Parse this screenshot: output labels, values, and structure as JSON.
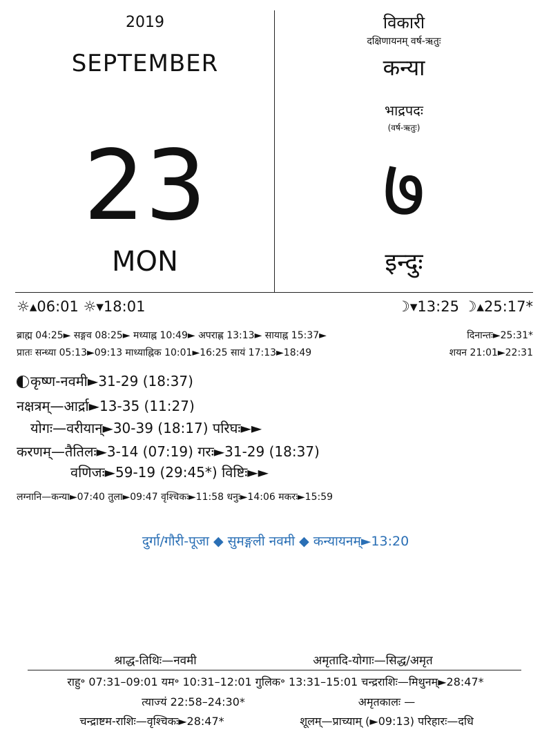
{
  "header": {
    "year": "2019",
    "month": "SEPTEMBER",
    "day": "23",
    "weekday": "MON",
    "samvatsara": "विकारी",
    "ayana_ritu": "दक्षिणायनम्   वर्ष-ऋतुः",
    "solar_month": "कन्या",
    "lunar_month": "भाद्रपदः",
    "lunar_ritu": "(वर्ष-ऋतुः)",
    "solar_day": "७",
    "vasara": "इन्दुः"
  },
  "sun_moon": {
    "sun_left": "☼▴06:01 ☼▾18:01",
    "moon_right": "☽▾13:25  ☽▴25:17*"
  },
  "kaala": {
    "line1_left": "ब्राह्म 04:25► सङ्गव 08:25► मध्याह्न 10:49► अपराह्ण 13:13► सायाह्न 15:37►",
    "line1_right": "दिनान्तः►25:31*",
    "line2_left": "प्रातः सन्ध्या 05:13►09:13 माध्याह्निक 10:01►16:25 सायं 17:13►18:49",
    "line2_right": "शयन 21:01►22:31"
  },
  "panchanga": {
    "tithi": "कृष्ण-नवमी►31-29 (18:37)",
    "nakshatra": "नक्षत्रम्—आर्द्रा►13-35 (11:27)",
    "yoga": "योगः—वरीयान्►30-39 (18:17)  परिघः►►",
    "karana1": "करणम्—तैतिलः►3-14 (07:19)  गरः►31-29 (18:37)",
    "karana2": "वणिजः►59-19 (29:45*)  विष्टिः►►",
    "lagna": "लग्नानि—कन्या►07:40 तुला►09:47 वृश्चिकः►11:58 धनुः►14:06 मकरः►15:59"
  },
  "festivals": {
    "text": "दुर्गा/गौरी-पूजा ◆ सुमङ्गली नवमी ◆ कन्यायनम्►13:20",
    "color": "#2a6fb5"
  },
  "footer": {
    "shraddha": "श्राद्ध-तिथिः—नवमी",
    "amritadi": "अमृतादि-योगाः—सिद्ध/अमृत",
    "row1": "राहु॰ 07:31–09:01   यम॰ 10:31–12:01   गुलिक॰ 13:31–15:01  चन्द्रराशिः—मिथुनम्►28:47*",
    "tyajyam": "त्याज्यं 22:58–24:30*",
    "amritakala": "अमृतकालः —",
    "chandrashtama": "चन्द्राष्टम-राशिः—वृश्चिकः►28:47*",
    "shula": "शूलम्—प्राच्याम् (►09:13) परिहारः—दधि"
  }
}
